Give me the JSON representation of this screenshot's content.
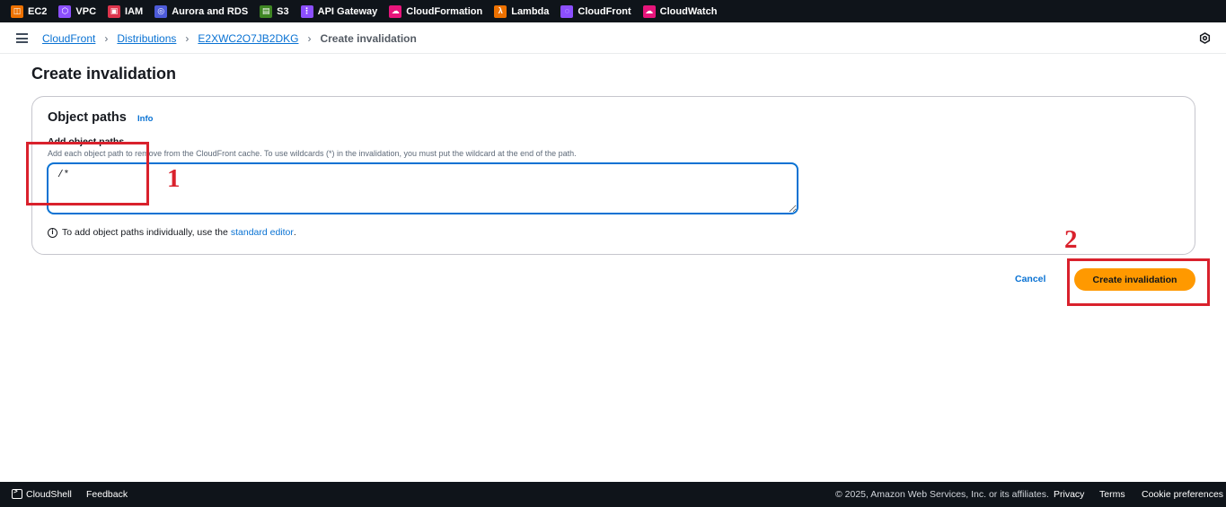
{
  "services": [
    {
      "label": "EC2",
      "icon": "ec2-icon",
      "color": "#ed7100",
      "glyph": "◫"
    },
    {
      "label": "VPC",
      "icon": "vpc-icon",
      "color": "#8c4fff",
      "glyph": "⬡"
    },
    {
      "label": "IAM",
      "icon": "iam-icon",
      "color": "#dd344c",
      "glyph": "▣"
    },
    {
      "label": "Aurora and RDS",
      "icon": "rds-icon",
      "color": "#4d5bd9",
      "glyph": "◎"
    },
    {
      "label": "S3",
      "icon": "s3-icon",
      "color": "#3f8624",
      "glyph": "▤"
    },
    {
      "label": "API Gateway",
      "icon": "api-gateway-icon",
      "color": "#8c4fff",
      "glyph": "⋮"
    },
    {
      "label": "CloudFormation",
      "icon": "cloudformation-icon",
      "color": "#e7157b",
      "glyph": "☁"
    },
    {
      "label": "Lambda",
      "icon": "lambda-icon",
      "color": "#ed7100",
      "glyph": "λ"
    },
    {
      "label": "CloudFront",
      "icon": "cloudfront-icon",
      "color": "#8c4fff",
      "glyph": "◌"
    },
    {
      "label": "CloudWatch",
      "icon": "cloudwatch-icon",
      "color": "#e7157b",
      "glyph": "☁"
    }
  ],
  "breadcrumb": {
    "cloudfront": "CloudFront",
    "distributions": "Distributions",
    "distribution_id": "E2XWC2O7JB2DKG",
    "current": "Create invalidation"
  },
  "page": {
    "title": "Create invalidation"
  },
  "object_paths": {
    "title": "Object paths",
    "info": "Info",
    "field_label": "Add object paths",
    "field_description": "Add each object path to remove from the CloudFront cache. To use wildcards (*) in the invalidation, you must put the wildcard at the end of the path.",
    "value": "/*",
    "hint_text": "To add object paths individually, use the",
    "hint_link": "standard editor",
    "hint_end": "."
  },
  "actions": {
    "cancel": "Cancel",
    "create": "Create invalidation"
  },
  "annotations": {
    "one": "1",
    "two": "2"
  },
  "footer": {
    "cloudshell": "CloudShell",
    "feedback": "Feedback",
    "copyright": "© 2025, Amazon Web Services, Inc. or its affiliates.",
    "privacy": "Privacy",
    "terms": "Terms",
    "cookies": "Cookie preferences"
  },
  "colors": {
    "accent": "#0972d3",
    "primary_button": "#ff9900",
    "annotation": "#d9212c",
    "topbar": "#0f141a"
  }
}
